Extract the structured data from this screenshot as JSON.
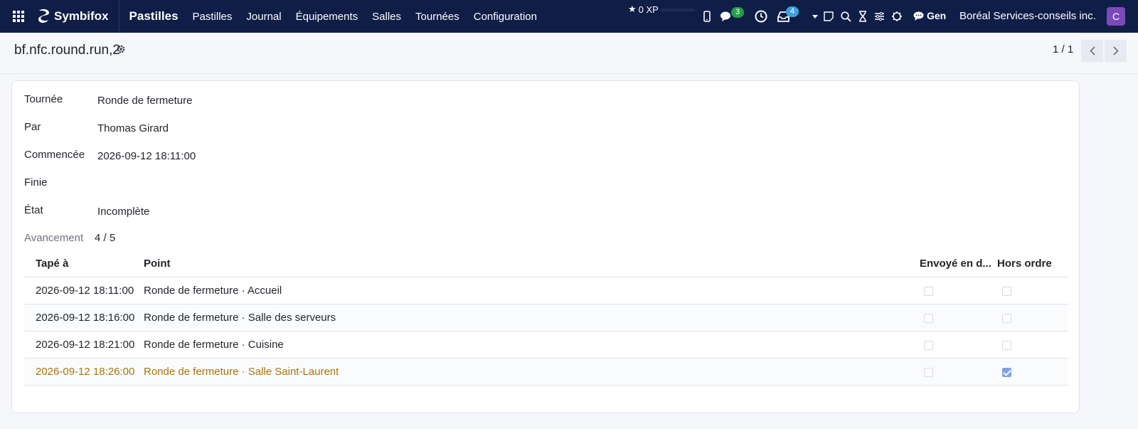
{
  "navbar": {
    "brand": "Symbifox",
    "app_name": "Pastilles",
    "menu": [
      "Pastilles",
      "Journal",
      "Équipements",
      "Salles",
      "Tournées",
      "Configuration"
    ],
    "xp": "0 XP",
    "messages_count": "3",
    "activities_count": "4",
    "gen_label": "Gen",
    "company": "Boréal Services-conseils inc.",
    "avatar_letter": "C",
    "colors": {
      "background": "#0f1e47",
      "avatar": "#7b4ab8",
      "badge_green": "#21a046",
      "badge_blue": "#3ea0d8"
    }
  },
  "control": {
    "record_title": "bf.nfc.round.run,2",
    "pager": "1 / 1"
  },
  "form": {
    "fields": [
      {
        "label": "Tournée",
        "value": "Ronde de fermeture"
      },
      {
        "label": "Par",
        "value": "Thomas Girard"
      },
      {
        "label": "Commencée",
        "value": "2026-09-12 18:11:00"
      },
      {
        "label": "Finie",
        "value": ""
      },
      {
        "label": "État",
        "value": "Incomplète"
      }
    ],
    "progress": {
      "label": "Avancement",
      "value": "4 / 5"
    }
  },
  "table": {
    "headers": {
      "tapped_at": "Tapé à",
      "point": "Point",
      "sent": "Envoyé en d...",
      "out_of_order": "Hors ordre"
    },
    "rows": [
      {
        "tapped_at": "2026-09-12 18:11:00",
        "point": "Ronde de fermeture · Accueil",
        "sent": false,
        "out_of_order": false
      },
      {
        "tapped_at": "2026-09-12 18:16:00",
        "point": "Ronde de fermeture · Salle des serveurs",
        "sent": false,
        "out_of_order": false
      },
      {
        "tapped_at": "2026-09-12 18:21:00",
        "point": "Ronde de fermeture · Cuisine",
        "sent": false,
        "out_of_order": false
      },
      {
        "tapped_at": "2026-09-12 18:26:00",
        "point": "Ronde de fermeture · Salle Saint-Laurent",
        "sent": false,
        "out_of_order": true
      }
    ],
    "warning_color": "#a8750a"
  }
}
